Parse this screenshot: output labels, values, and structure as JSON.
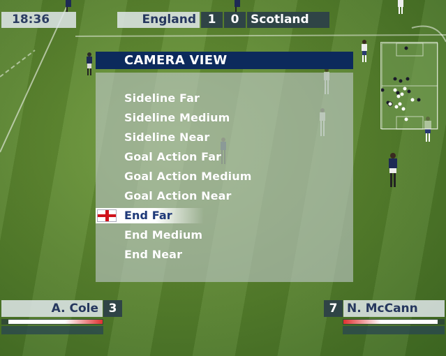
{
  "hud": {
    "clock": "18:36",
    "home_team": "England",
    "home_score": "1",
    "away_score": "0",
    "away_team": "Scotland"
  },
  "menu": {
    "title": "CAMERA VIEW",
    "items": [
      "Sideline Far",
      "Sideline Medium",
      "Sideline Near",
      "Goal Action Far",
      "Goal Action Medium",
      "Goal Action Near",
      "End Far",
      "End Medium",
      "End Near"
    ],
    "selected_index": 6
  },
  "players": {
    "left": {
      "name": "A. Cole",
      "number": "3",
      "stamina": 1.0
    },
    "right": {
      "name": "N. McCann",
      "number": "7",
      "stamina": 1.0
    }
  },
  "colors": {
    "menu_title_bg": "#0c2a5c",
    "hud_dark": "#2f4446",
    "hud_light": "#e1e8eb",
    "selected_text": "#1f3a7a",
    "flag_red": "#d0121b"
  },
  "icons": {
    "selected_marker": "england-flag-icon"
  }
}
